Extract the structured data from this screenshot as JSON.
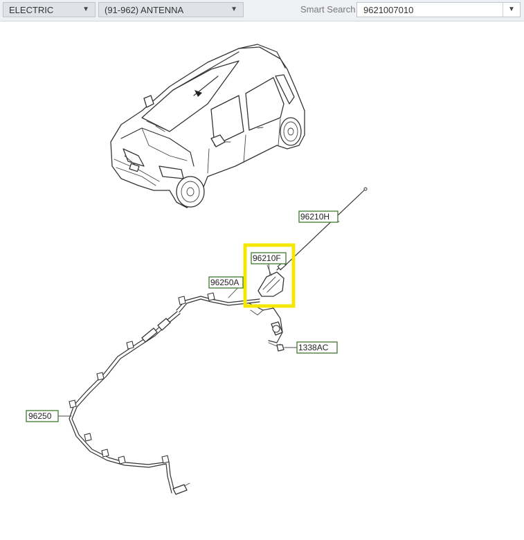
{
  "toolbar": {
    "category_select": {
      "value": "ELECTRIC"
    },
    "group_select": {
      "value": "(91-962) ANTENNA"
    },
    "smart_search": {
      "label": "Smart Search",
      "value": "9621007010"
    }
  },
  "diagram": {
    "callouts": [
      {
        "id": "96210H",
        "label": "96210H"
      },
      {
        "id": "96210F",
        "label": "96210F",
        "highlighted": true
      },
      {
        "id": "96250A",
        "label": "96250A"
      },
      {
        "id": "1338AC",
        "label": "1338AC"
      },
      {
        "id": "96250",
        "label": "96250"
      }
    ],
    "highlight_color": "#f5e800",
    "callout_border_color": "#3c7a2e"
  }
}
